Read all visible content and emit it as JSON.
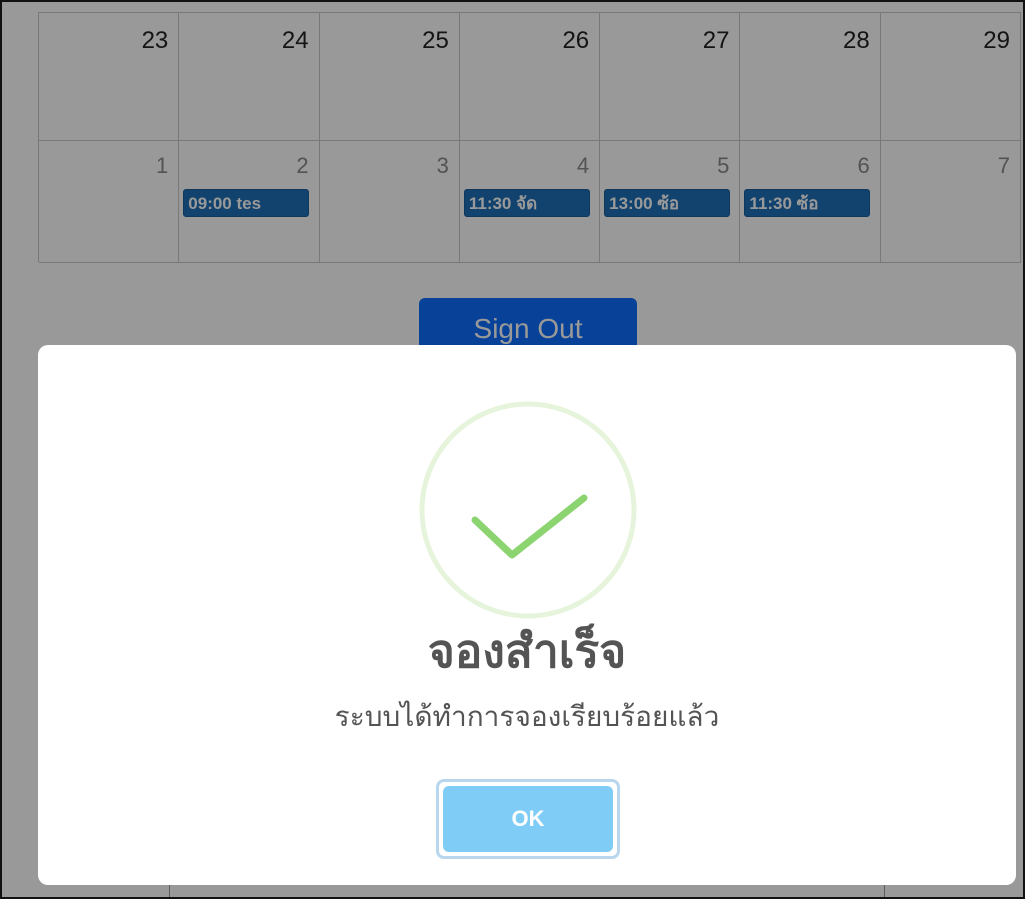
{
  "calendar": {
    "week1": [
      {
        "day": "23"
      },
      {
        "day": "24"
      },
      {
        "day": "25"
      },
      {
        "day": "26"
      },
      {
        "day": "27"
      },
      {
        "day": "28"
      },
      {
        "day": "29"
      }
    ],
    "week2": [
      {
        "day": "1",
        "event": ""
      },
      {
        "day": "2",
        "event": "09:00 tes"
      },
      {
        "day": "3",
        "event": ""
      },
      {
        "day": "4",
        "event": "11:30 จัด"
      },
      {
        "day": "5",
        "event": "13:00 ซ้อ"
      },
      {
        "day": "6",
        "event": "11:30 ซ้อ"
      },
      {
        "day": "7",
        "event": ""
      }
    ]
  },
  "header": {
    "sign_out_label": "Sign Out"
  },
  "modal": {
    "icon": "success-check-icon",
    "title": "จองสำเร็จ",
    "message": "ระบบได้ทำการจองเรียบร้อยแล้ว",
    "ok_label": "OK"
  },
  "colors": {
    "event_bg": "#1f6fb8",
    "sign_out_bg": "#0d6efd",
    "ok_bg": "#7fcdf6",
    "check": "#8cd470"
  }
}
